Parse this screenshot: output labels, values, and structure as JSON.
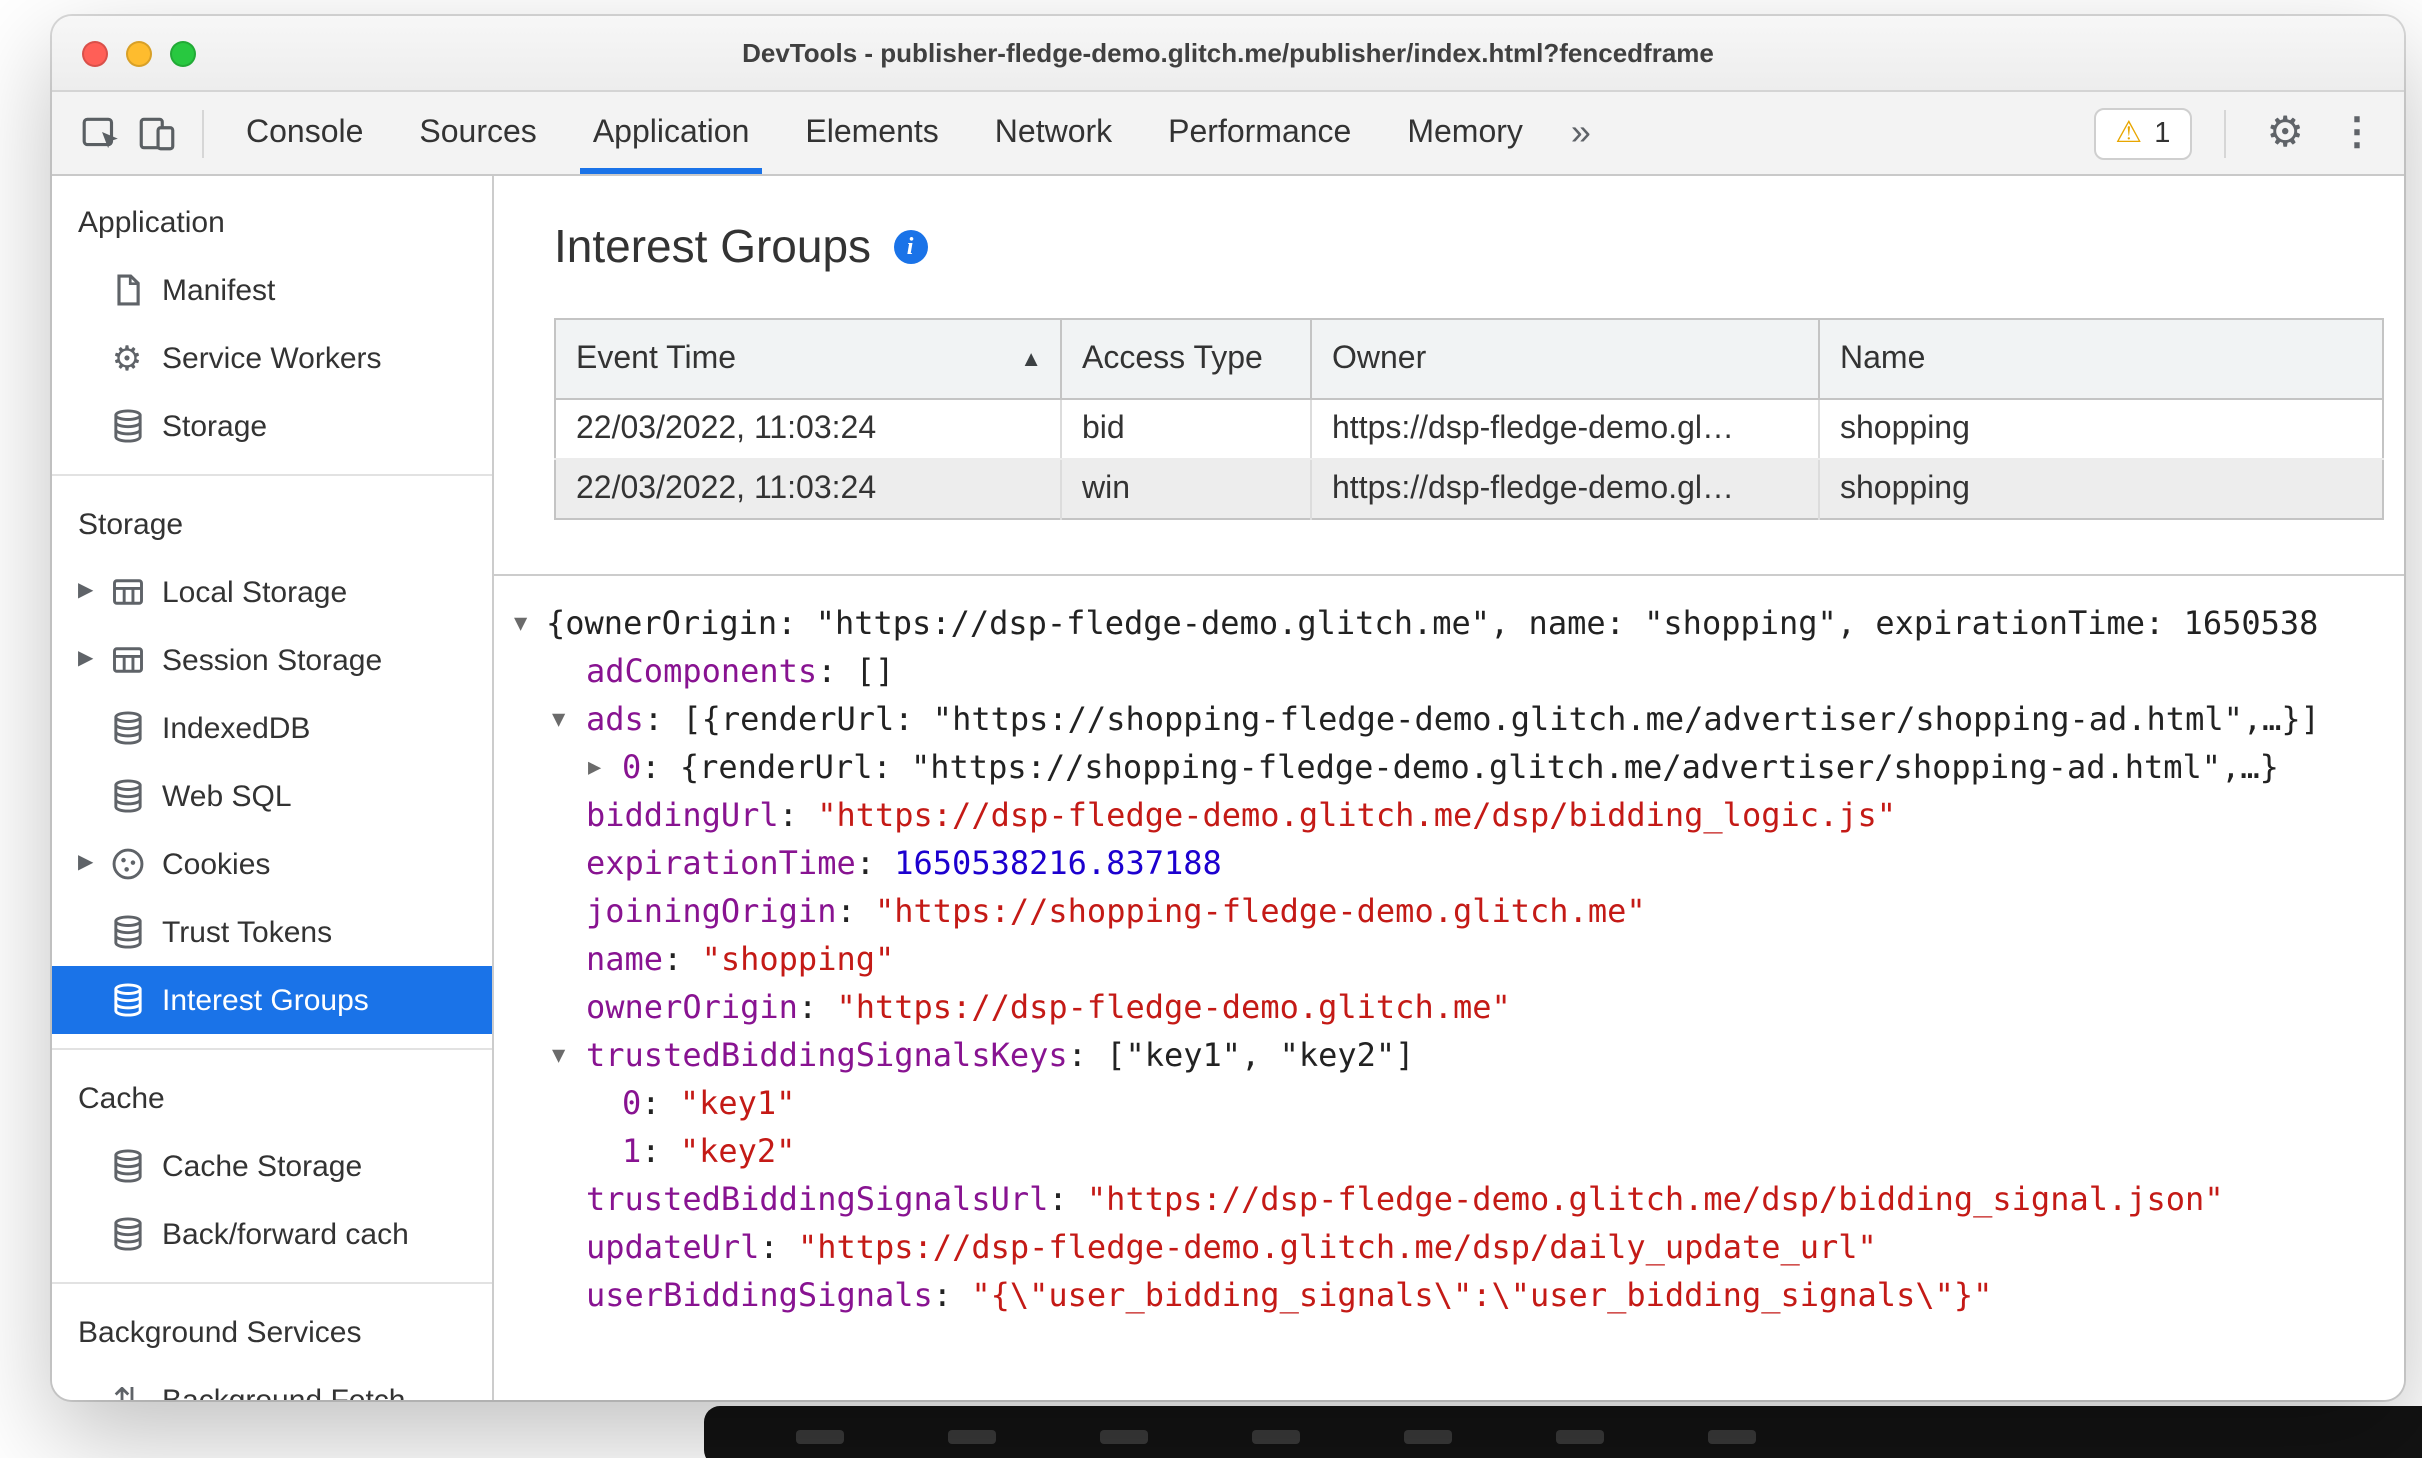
{
  "window": {
    "title": "DevTools - publisher-fledge-demo.glitch.me/publisher/index.html?fencedframe"
  },
  "colors": {
    "accent": "#1a73e8",
    "traffic-red": "#ff5f57",
    "traffic-yellow": "#febc2e",
    "traffic-green": "#28c840",
    "warning": "#e8a600",
    "token-key": "#881391",
    "token-string": "#c41a16",
    "token-number": "#1c00cf"
  },
  "icons": {
    "more_tabs": "»",
    "warning": "⚠",
    "gear": "⚙",
    "menu_dots": "⋮",
    "expanded": "▼",
    "collapsed": "▶",
    "sort_asc": "▲",
    "info": "i",
    "up_down_arrows": "⇅"
  },
  "toolbar": {
    "tabs": [
      "Console",
      "Sources",
      "Application",
      "Elements",
      "Network",
      "Performance",
      "Memory"
    ],
    "active_tab": "Application",
    "warning_count": "1"
  },
  "sidebar": {
    "selected": "Interest Groups",
    "sections": [
      {
        "title": "Application",
        "items": [
          {
            "label": "Manifest",
            "icon": "manifest"
          },
          {
            "label": "Service Workers",
            "icon": "gear"
          },
          {
            "label": "Storage",
            "icon": "database"
          }
        ]
      },
      {
        "title": "Storage",
        "items": [
          {
            "label": "Local Storage",
            "icon": "table",
            "expandable": true
          },
          {
            "label": "Session Storage",
            "icon": "table",
            "expandable": true
          },
          {
            "label": "IndexedDB",
            "icon": "database"
          },
          {
            "label": "Web SQL",
            "icon": "database"
          },
          {
            "label": "Cookies",
            "icon": "cookie",
            "expandable": true
          },
          {
            "label": "Trust Tokens",
            "icon": "database"
          },
          {
            "label": "Interest Groups",
            "icon": "database"
          }
        ]
      },
      {
        "title": "Cache",
        "items": [
          {
            "label": "Cache Storage",
            "icon": "database"
          },
          {
            "label": "Back/forward cach",
            "icon": "database"
          }
        ]
      },
      {
        "title": "Background Services",
        "items": [
          {
            "label": "Background Fetch",
            "icon": "up_down_arrows"
          }
        ]
      }
    ]
  },
  "main": {
    "title": "Interest Groups",
    "table": {
      "columns": [
        "Event Time",
        "Access Type",
        "Owner",
        "Name"
      ],
      "sorted_column": "Event Time",
      "selected_row_index": 1,
      "rows": [
        [
          "22/03/2022, 11:03:24",
          "bid",
          "https://dsp-fledge-demo.gl…",
          "shopping"
        ],
        [
          "22/03/2022, 11:03:24",
          "win",
          "https://dsp-fledge-demo.gl…",
          "shopping"
        ]
      ]
    },
    "tree": {
      "lines": [
        {
          "indent": 0,
          "arrow": "down",
          "parts": [
            {
              "c": "plain",
              "t": "{ownerOrigin: \"https://dsp-fledge-demo.glitch.me\", name: \"shopping\", expirationTime: 1650538"
            }
          ]
        },
        {
          "indent": 1,
          "parts": [
            {
              "c": "key",
              "t": "adComponents"
            },
            {
              "c": "plain",
              "t": ": []"
            }
          ]
        },
        {
          "indent": 1,
          "arrow": "down",
          "parts": [
            {
              "c": "key",
              "t": "ads"
            },
            {
              "c": "plain",
              "t": ": [{renderUrl: \"https://shopping-fledge-demo.glitch.me/advertiser/shopping-ad.html\",…}]"
            }
          ]
        },
        {
          "indent": 2,
          "arrow": "right",
          "parts": [
            {
              "c": "key",
              "t": "0"
            },
            {
              "c": "plain",
              "t": ": {renderUrl: \"https://shopping-fledge-demo.glitch.me/advertiser/shopping-ad.html\",…}"
            }
          ]
        },
        {
          "indent": 1,
          "parts": [
            {
              "c": "key",
              "t": "biddingUrl"
            },
            {
              "c": "plain",
              "t": ": "
            },
            {
              "c": "string",
              "t": "\"https://dsp-fledge-demo.glitch.me/dsp/bidding_logic.js\""
            }
          ]
        },
        {
          "indent": 1,
          "parts": [
            {
              "c": "key",
              "t": "expirationTime"
            },
            {
              "c": "plain",
              "t": ": "
            },
            {
              "c": "number",
              "t": "1650538216.837188"
            }
          ]
        },
        {
          "indent": 1,
          "parts": [
            {
              "c": "key",
              "t": "joiningOrigin"
            },
            {
              "c": "plain",
              "t": ": "
            },
            {
              "c": "string",
              "t": "\"https://shopping-fledge-demo.glitch.me\""
            }
          ]
        },
        {
          "indent": 1,
          "parts": [
            {
              "c": "key",
              "t": "name"
            },
            {
              "c": "plain",
              "t": ": "
            },
            {
              "c": "string",
              "t": "\"shopping\""
            }
          ]
        },
        {
          "indent": 1,
          "parts": [
            {
              "c": "key",
              "t": "ownerOrigin"
            },
            {
              "c": "plain",
              "t": ": "
            },
            {
              "c": "string",
              "t": "\"https://dsp-fledge-demo.glitch.me\""
            }
          ]
        },
        {
          "indent": 1,
          "arrow": "down",
          "parts": [
            {
              "c": "key",
              "t": "trustedBiddingSignalsKeys"
            },
            {
              "c": "plain",
              "t": ": [\"key1\", \"key2\"]"
            }
          ]
        },
        {
          "indent": 2,
          "parts": [
            {
              "c": "key",
              "t": "0"
            },
            {
              "c": "plain",
              "t": ": "
            },
            {
              "c": "string",
              "t": "\"key1\""
            }
          ]
        },
        {
          "indent": 2,
          "parts": [
            {
              "c": "key",
              "t": "1"
            },
            {
              "c": "plain",
              "t": ": "
            },
            {
              "c": "string",
              "t": "\"key2\""
            }
          ]
        },
        {
          "indent": 1,
          "parts": [
            {
              "c": "key",
              "t": "trustedBiddingSignalsUrl"
            },
            {
              "c": "plain",
              "t": ": "
            },
            {
              "c": "string",
              "t": "\"https://dsp-fledge-demo.glitch.me/dsp/bidding_signal.json\""
            }
          ]
        },
        {
          "indent": 1,
          "parts": [
            {
              "c": "key",
              "t": "updateUrl"
            },
            {
              "c": "plain",
              "t": ": "
            },
            {
              "c": "string",
              "t": "\"https://dsp-fledge-demo.glitch.me/dsp/daily_update_url\""
            }
          ]
        },
        {
          "indent": 1,
          "parts": [
            {
              "c": "key",
              "t": "userBiddingSignals"
            },
            {
              "c": "plain",
              "t": ": "
            },
            {
              "c": "string",
              "t": "\"{\\\"user_bidding_signals\\\":\\\"user_bidding_signals\\\"}\""
            }
          ]
        }
      ]
    }
  }
}
